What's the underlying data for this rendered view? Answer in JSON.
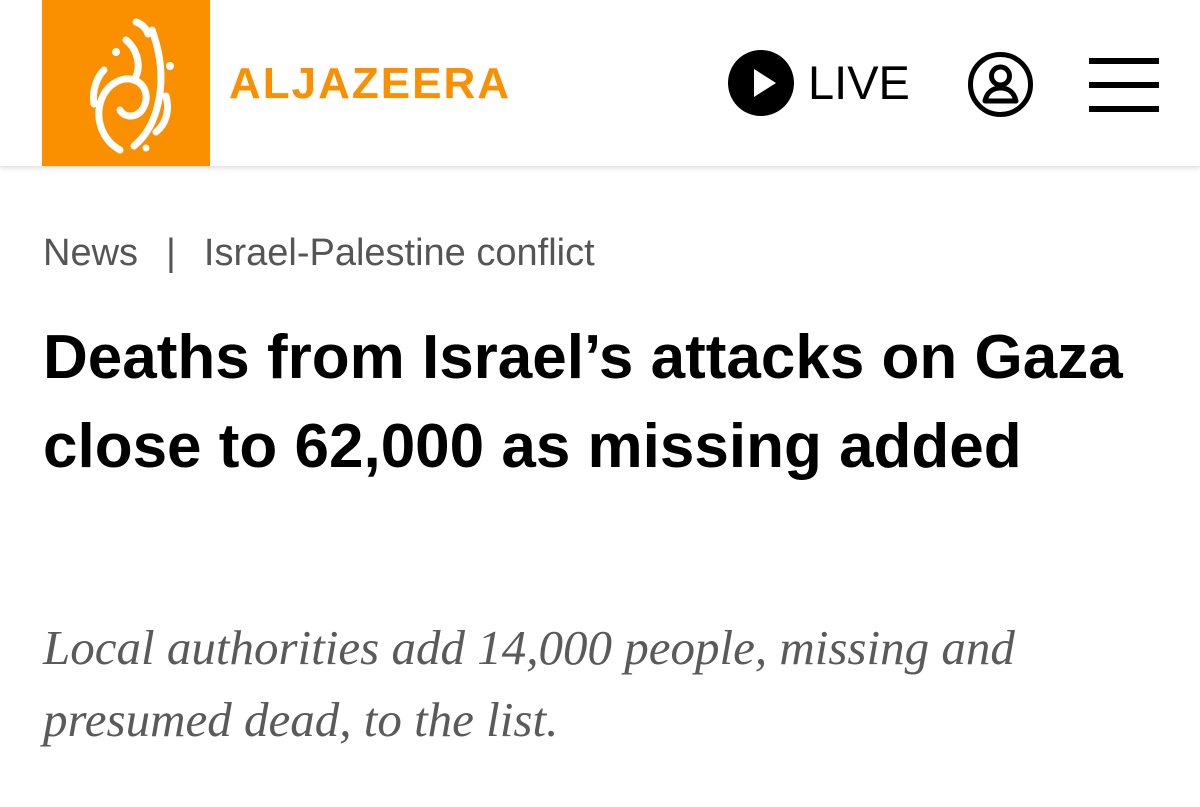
{
  "header": {
    "brand_name": "ALJAZEERA",
    "logo_icon": "al-jazeera-calligraphy-logo",
    "live_label": "LIVE",
    "live_icon": "play-circle-icon",
    "account_icon": "user-circle-icon",
    "menu_icon": "hamburger-menu-icon"
  },
  "breadcrumb": {
    "items": [
      "News",
      "Israel-Palestine conflict"
    ],
    "separator": "|"
  },
  "article": {
    "headline": "Deaths from Israel’s attacks on Gaza close to 62,000 as missing added",
    "subheadline": "Local authorities add 14,000 people, missing and presumed dead, to the list."
  },
  "colors": {
    "brand_orange": "#fa9000",
    "text_primary": "#000000",
    "text_secondary": "#555555"
  }
}
